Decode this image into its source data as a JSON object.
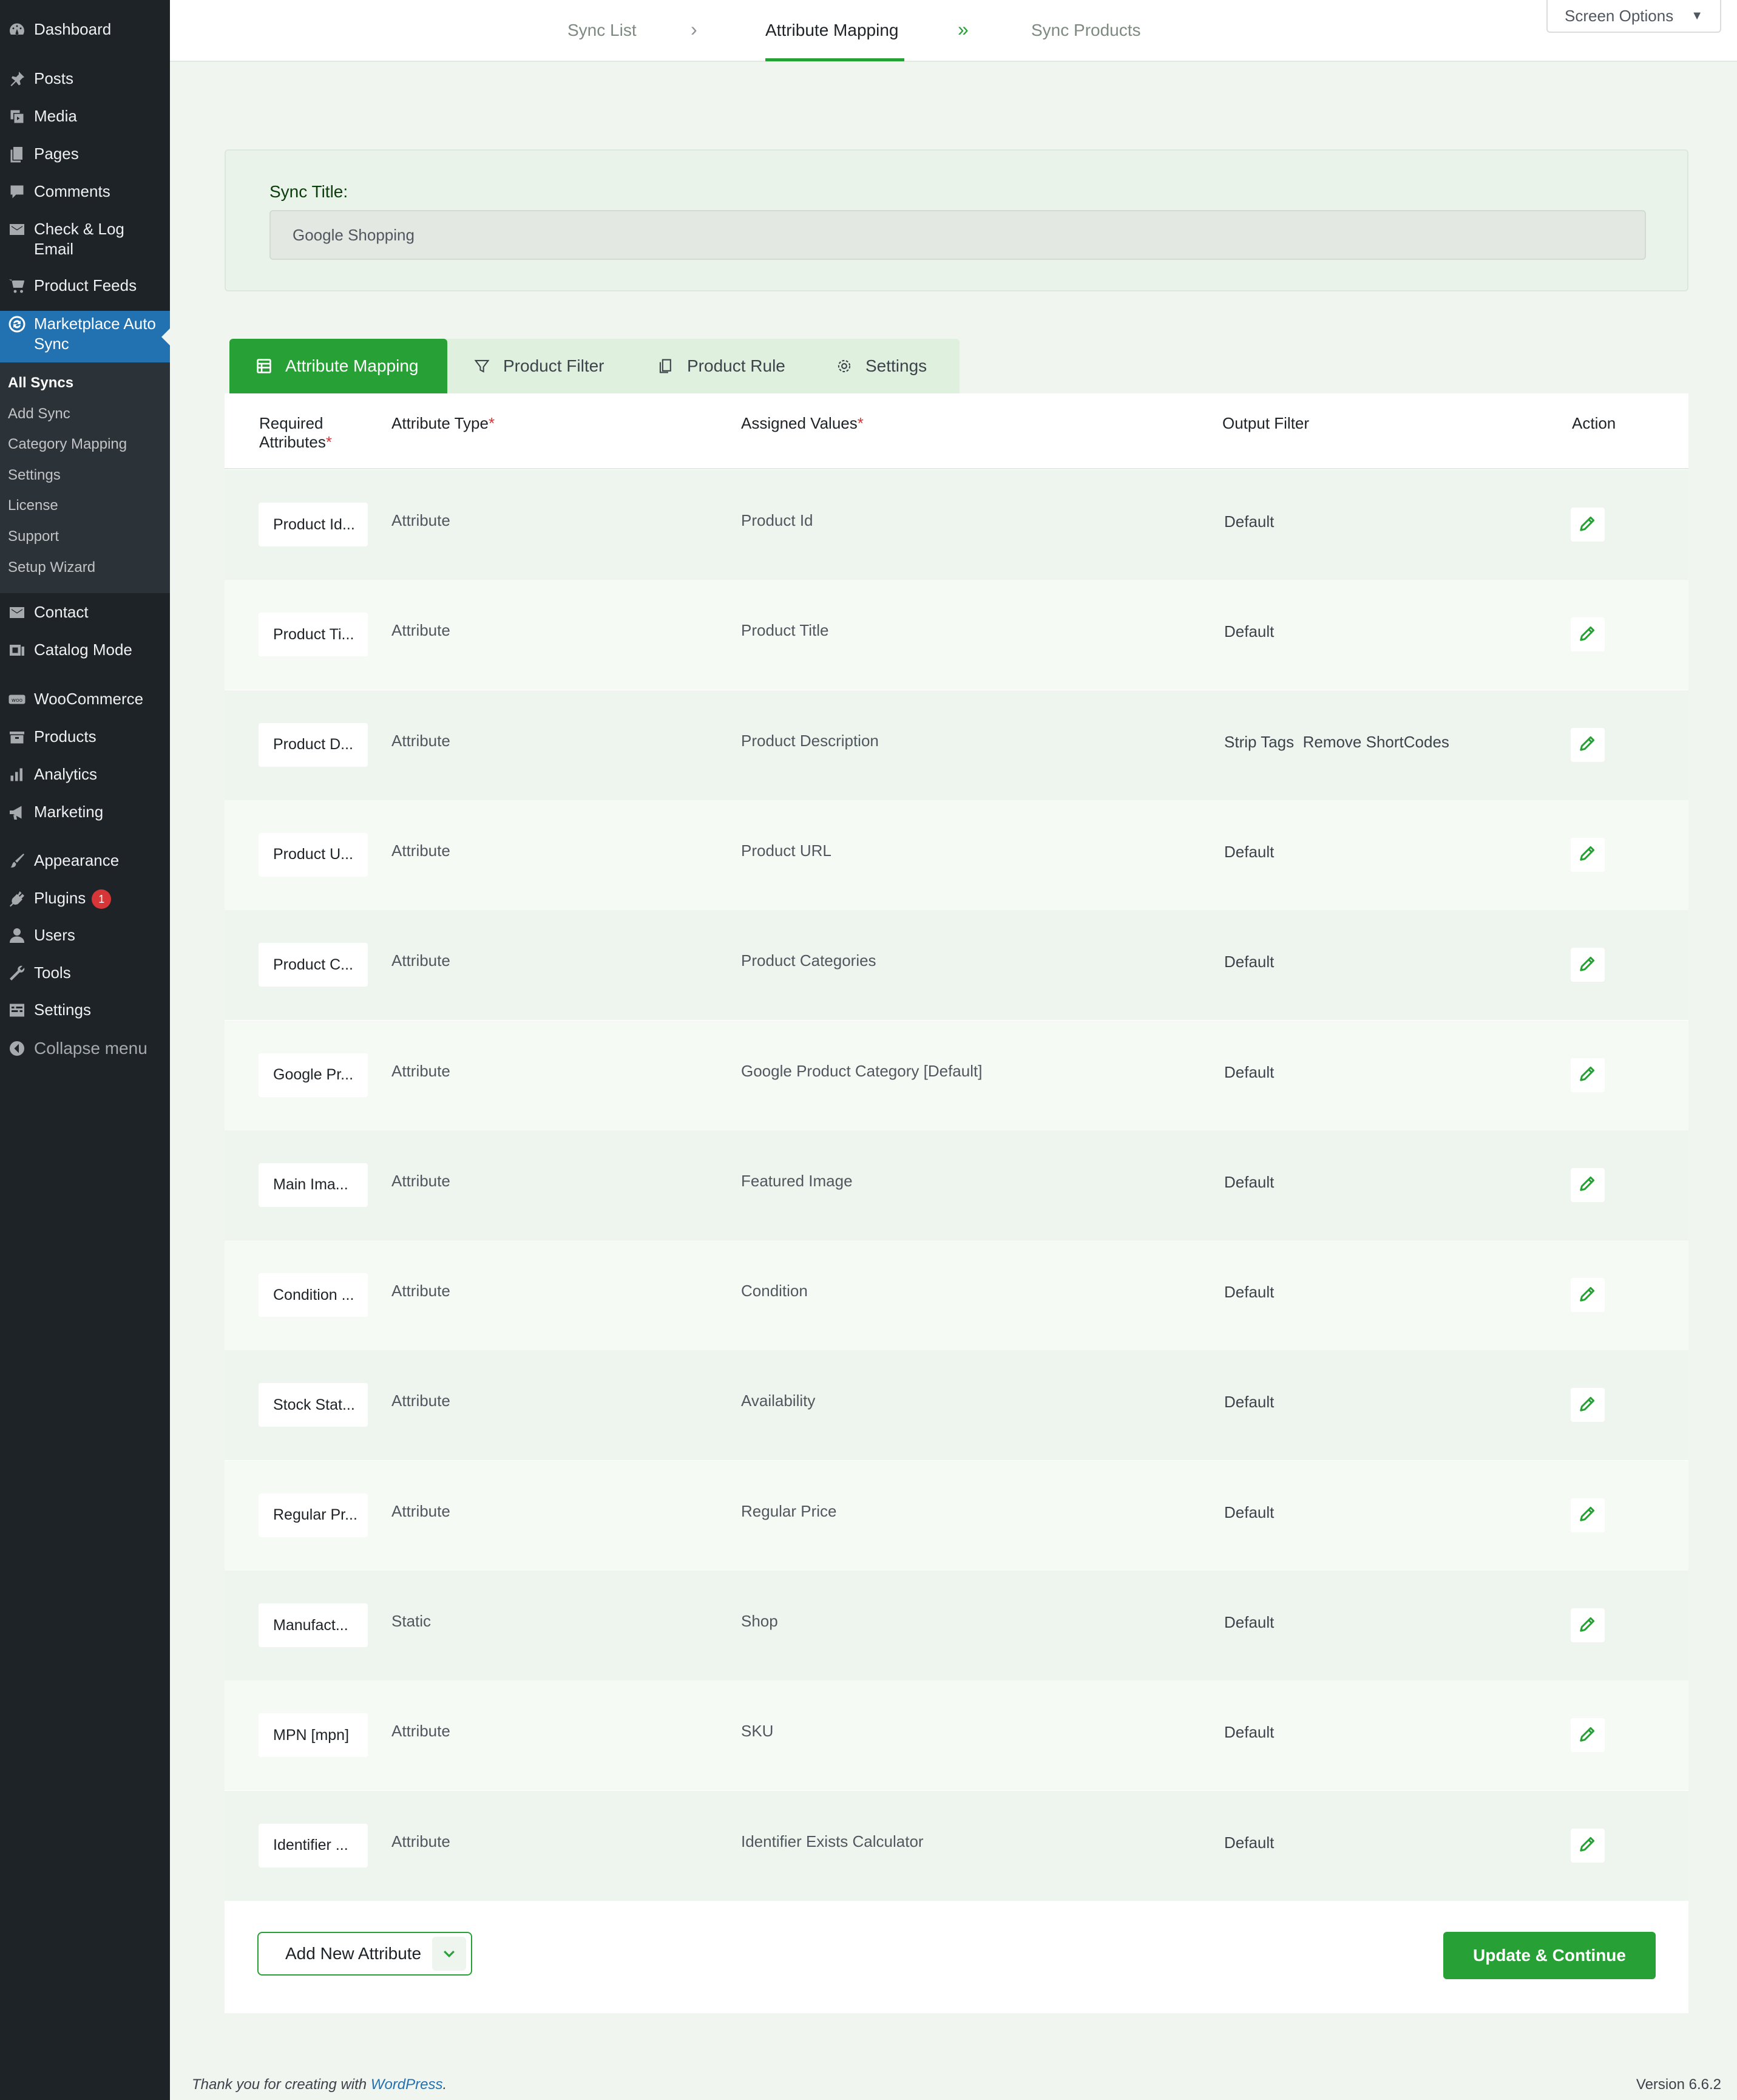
{
  "sidebar": {
    "items": [
      {
        "label": "Dashboard",
        "icon": "dashboard-icon"
      },
      {
        "label": "Posts",
        "icon": "pin-icon"
      },
      {
        "label": "Media",
        "icon": "media-icon"
      },
      {
        "label": "Pages",
        "icon": "pages-icon"
      },
      {
        "label": "Comments",
        "icon": "comments-icon"
      },
      {
        "label": "Check & Log Email",
        "icon": "email-icon"
      },
      {
        "label": "Product Feeds",
        "icon": "cart-icon"
      },
      {
        "label": "Marketplace Auto Sync",
        "icon": "sync-icon"
      },
      {
        "label": "Contact",
        "icon": "email-icon"
      },
      {
        "label": "Catalog Mode",
        "icon": "catalog-icon"
      },
      {
        "label": "WooCommerce",
        "icon": "woo-icon"
      },
      {
        "label": "Products",
        "icon": "archive-icon"
      },
      {
        "label": "Analytics",
        "icon": "chart-icon"
      },
      {
        "label": "Marketing",
        "icon": "megaphone-icon"
      },
      {
        "label": "Appearance",
        "icon": "brush-icon"
      },
      {
        "label": "Plugins",
        "icon": "plugin-icon"
      },
      {
        "label": "Users",
        "icon": "users-icon"
      },
      {
        "label": "Tools",
        "icon": "wrench-icon"
      },
      {
        "label": "Settings",
        "icon": "settings-icon"
      },
      {
        "label": "Collapse menu",
        "icon": "collapse-icon"
      }
    ],
    "plugins_badge": "1",
    "submenu": [
      "All Syncs",
      "Add Sync",
      "Category Mapping",
      "Settings",
      "License",
      "Support",
      "Setup Wizard"
    ]
  },
  "topbar": {
    "steps": [
      "Sync List",
      "Attribute Mapping",
      "Sync Products"
    ],
    "screen_options": "Screen Options"
  },
  "sync_title": {
    "label": "Sync Title:",
    "value": "Google Shopping"
  },
  "tabs": [
    "Attribute Mapping",
    "Product Filter",
    "Product Rule",
    "Settings"
  ],
  "table": {
    "headers": {
      "required_line1": "Required",
      "required_line2": "Attributes",
      "attribute_type": "Attribute Type",
      "assigned_values": "Assigned Values",
      "output_filter": "Output Filter",
      "action": "Action",
      "required_mark": "*"
    },
    "rows": [
      {
        "attr": "Product Id...",
        "type": "Attribute",
        "value": "Product Id",
        "filter": "Default"
      },
      {
        "attr": "Product Ti...",
        "type": "Attribute",
        "value": "Product Title",
        "filter": "Default"
      },
      {
        "attr": "Product D...",
        "type": "Attribute",
        "value": "Product Description",
        "filter": "Strip Tags  Remove ShortCodes"
      },
      {
        "attr": "Product U...",
        "type": "Attribute",
        "value": "Product URL",
        "filter": "Default"
      },
      {
        "attr": "Product C...",
        "type": "Attribute",
        "value": "Product Categories",
        "filter": "Default"
      },
      {
        "attr": "Google Pr...",
        "type": "Attribute",
        "value": "Google Product Category [Default]",
        "filter": "Default"
      },
      {
        "attr": "Main Ima...",
        "type": "Attribute",
        "value": "Featured Image",
        "filter": "Default"
      },
      {
        "attr": "Condition ...",
        "type": "Attribute",
        "value": "Condition",
        "filter": "Default"
      },
      {
        "attr": "Stock Stat...",
        "type": "Attribute",
        "value": "Availability",
        "filter": "Default"
      },
      {
        "attr": "Regular Pr...",
        "type": "Attribute",
        "value": "Regular Price",
        "filter": "Default"
      },
      {
        "attr": "Manufact...",
        "type": "Static",
        "value": "Shop",
        "filter": "Default"
      },
      {
        "attr": "MPN [mpn]",
        "type": "Attribute",
        "value": "SKU",
        "filter": "Default"
      },
      {
        "attr": "Identifier ...",
        "type": "Attribute",
        "value": "Identifier Exists Calculator",
        "filter": "Default"
      }
    ]
  },
  "buttons": {
    "add_new_attribute": "Add New Attribute",
    "update_continue": "Update & Continue"
  },
  "footer": {
    "thanks_prefix": "Thank you for creating with ",
    "wordpress_link": "WordPress",
    "thanks_suffix": ".",
    "version": "Version 6.6.2"
  },
  "colors": {
    "accent_green": "#27a136",
    "wp_blue": "#2271b1",
    "sidebar_bg": "#1d2327",
    "required_red": "#d63638"
  }
}
